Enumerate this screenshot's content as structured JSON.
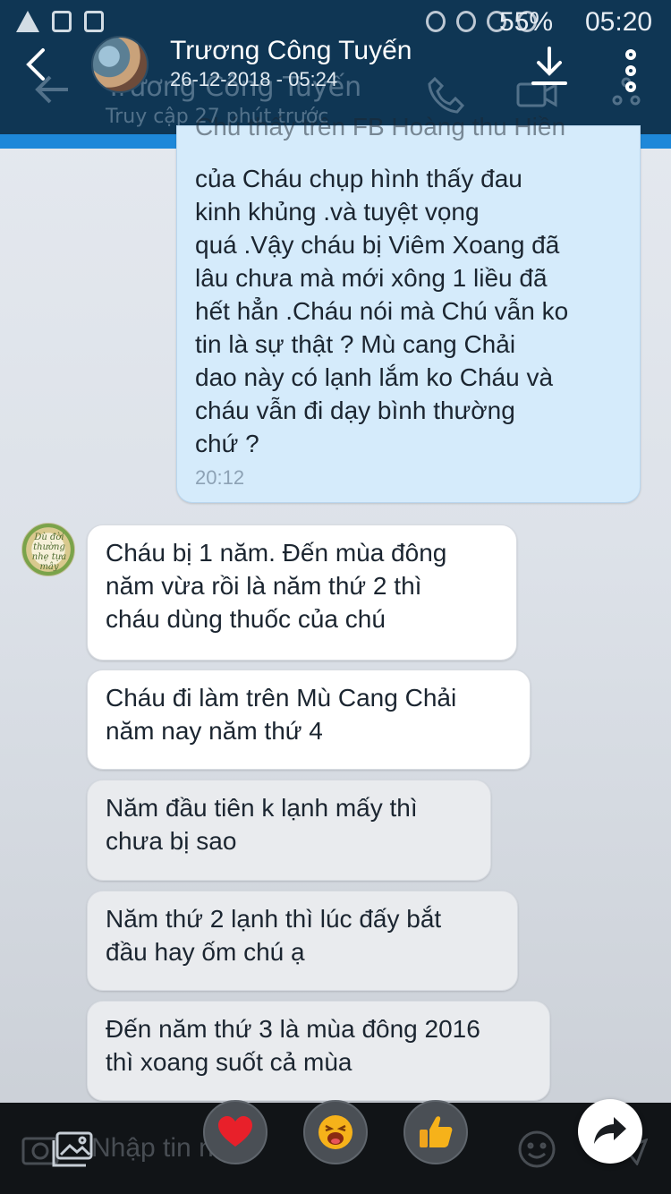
{
  "status_bar": {
    "battery": "55%",
    "time": "05:20"
  },
  "viewer_header": {
    "title": "Trương Công Tuyến",
    "date": "26-12-2018 - 05:24"
  },
  "chat_header": {
    "contact_name": "Trương Công Tuyến",
    "last_seen": "Truy cập 27 phút trước"
  },
  "messages": {
    "outgoing": {
      "lines": [
        "Chú thấy trên FB Hoàng thu Hiền",
        "của Cháu chụp hình thấy đau",
        "kinh khủng .và tuyệt vọng",
        "quá .Vậy cháu bị Viêm Xoang đã",
        "lâu chưa mà mới xông 1 liều đã",
        "hết hẳn .Cháu nói mà Chú vẫn ko",
        "tin là sự thật ?  Mù cang Chải",
        "dao này có lạnh lắm ko Cháu và",
        "cháu vẫn đi dạy bình thường",
        "chứ ?"
      ],
      "time": "20:12"
    },
    "incoming": [
      {
        "lines": [
          "Cháu bị 1 năm. Đến mùa đông",
          "năm vừa rồi là năm thứ 2 thì",
          "cháu dùng thuốc của chú"
        ]
      },
      {
        "lines": [
          "Cháu đi làm trên Mù Cang Chải",
          "năm nay năm thứ 4"
        ]
      },
      {
        "lines": [
          "Năm đầu tiên k lạnh mấy thì",
          "chưa bị sao"
        ]
      },
      {
        "lines": [
          "Năm thứ 2 lạnh thì lúc đấy bắt",
          "đầu hay ốm chú ạ"
        ]
      },
      {
        "lines": [
          "Đến năm thứ 3 là mùa đông 2016",
          "thì xoang suốt cả mùa"
        ]
      }
    ],
    "sender_avatar_text": "Dù đời thường nhẹ tựa mây"
  },
  "composer": {
    "placeholder": "Nhập tin nhắn"
  },
  "icons": {
    "heart": "heart-icon",
    "laugh": "laugh-icon",
    "like": "thumbs-up-icon",
    "share": "share-icon"
  },
  "colors": {
    "header_bg": "#0f3654",
    "accent_strip": "#1e88d9",
    "outgoing_bubble": "#d5ebfb",
    "incoming_bubble": "#ffffff"
  }
}
